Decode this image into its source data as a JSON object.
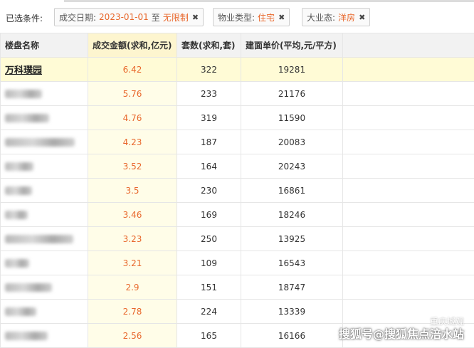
{
  "filters": {
    "title": "已选条件:",
    "chips": [
      {
        "label": "成交日期:",
        "value_from": "2023-01-01",
        "sep": "至",
        "value_to": "无限制"
      },
      {
        "label": "物业类型:",
        "value": "住宅"
      },
      {
        "label": "大业态:",
        "value": "洋房"
      }
    ],
    "remove_glyph": "✖"
  },
  "table": {
    "headers": [
      "楼盘名称",
      "成交金额(求和,亿元)",
      "套数(求和,套)",
      "建面单价(平均,元/平方)"
    ],
    "rows": [
      {
        "name": "万科璞园",
        "amount": "6.42",
        "units": "322",
        "price": "19281"
      },
      {
        "name": "",
        "amount": "5.76",
        "units": "233",
        "price": "21176"
      },
      {
        "name": "",
        "amount": "4.76",
        "units": "319",
        "price": "11590"
      },
      {
        "name": "",
        "amount": "4.23",
        "units": "187",
        "price": "20083"
      },
      {
        "name": "",
        "amount": "3.52",
        "units": "164",
        "price": "20243"
      },
      {
        "name": "",
        "amount": "3.5",
        "units": "230",
        "price": "16861"
      },
      {
        "name": "",
        "amount": "3.46",
        "units": "169",
        "price": "18246"
      },
      {
        "name": "",
        "amount": "3.23",
        "units": "250",
        "price": "13925"
      },
      {
        "name": "",
        "amount": "3.21",
        "units": "109",
        "price": "16543"
      },
      {
        "name": "",
        "amount": "2.9",
        "units": "151",
        "price": "18747"
      },
      {
        "name": "",
        "amount": "2.78",
        "units": "224",
        "price": "13339"
      },
      {
        "name": "",
        "amount": "2.56",
        "units": "165",
        "price": "16166"
      }
    ]
  },
  "watermark": {
    "main": "搜狐号@搜狐焦点涪水站",
    "faint": "重庆城观"
  },
  "colors": {
    "accent": "#e8672b",
    "header_bg": "#f2f2f2",
    "highlight_col": "#fffde8",
    "first_row": "#fffbd6"
  }
}
